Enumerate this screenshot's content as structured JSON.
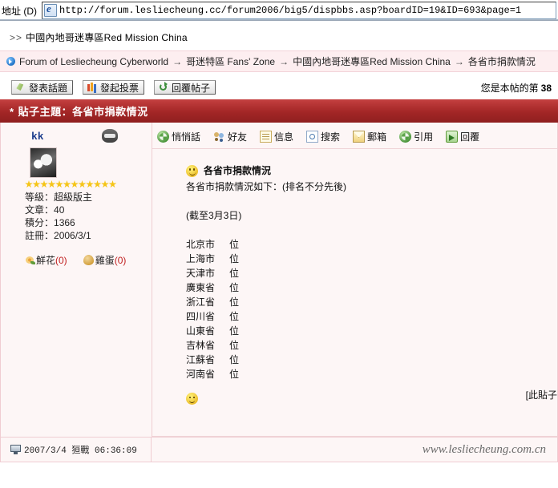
{
  "browser": {
    "address_label": "地址 (D)",
    "url": "http://forum.lesliecheung.cc/forum2006/big5/dispbbs.asp?boardID=19&ID=693&page=1"
  },
  "subforum": {
    "prefix": ">>",
    "name": "中國內地哥迷專區Red Mission China"
  },
  "breadcrumb": {
    "items": [
      "Forum of Lesliecheung Cyberworld",
      "哥迷特區 Fans' Zone",
      "中國內地哥迷專區Red Mission China",
      "各省市捐款情況"
    ],
    "separator": "→"
  },
  "toolbar": {
    "new_topic": "發表話題",
    "new_poll": "發起投票",
    "reply_post": "回覆帖子",
    "visit_count_prefix": "您是本帖的第",
    "visit_count": "38"
  },
  "title_bar": {
    "marker": "*",
    "text": "貼子主題：各省市捐款情況"
  },
  "user": {
    "name": "kk",
    "stars": 12,
    "level_label": "等級：",
    "level_value": "超級版主",
    "posts_label": "文章：",
    "posts_value": "40",
    "points_label": "積分：",
    "points_value": "1366",
    "joined_label": "註冊：",
    "joined_value": "2006/3/1",
    "flower_label": "鮮花",
    "flower_count": "(0)",
    "egg_label": "雞蛋",
    "egg_count": "(0)"
  },
  "actions": [
    {
      "label": "悄悄話",
      "icon": "whisper-icon"
    },
    {
      "label": "好友",
      "icon": "friends-icon"
    },
    {
      "label": "信息",
      "icon": "info-icon"
    },
    {
      "label": "搜索",
      "icon": "search-icon"
    },
    {
      "label": "郵箱",
      "icon": "mail-icon"
    },
    {
      "label": "引用",
      "icon": "quote-icon"
    },
    {
      "label": "回覆",
      "icon": "reply-icon"
    }
  ],
  "post": {
    "subject": "各省市捐款情況",
    "intro": "各省市捐款情況如下：(排名不分先後)",
    "as_of": "(截至3月3日)",
    "rows": [
      {
        "region": "北京市",
        "unit": "位"
      },
      {
        "region": "上海市",
        "unit": "位"
      },
      {
        "region": "天津市",
        "unit": "位"
      },
      {
        "region": "廣東省",
        "unit": "位"
      },
      {
        "region": "浙江省",
        "unit": "位"
      },
      {
        "region": "四川省",
        "unit": "位"
      },
      {
        "region": "山東省",
        "unit": "位"
      },
      {
        "region": "吉林省",
        "unit": "位"
      },
      {
        "region": "江蘇省",
        "unit": "位"
      },
      {
        "region": "河南省",
        "unit": "位"
      }
    ],
    "edit_note": "[此貼子"
  },
  "footer": {
    "timestamp": "2007/3/4 狟戰 06:36:09",
    "site": "www.lesliecheung.com.cn"
  }
}
